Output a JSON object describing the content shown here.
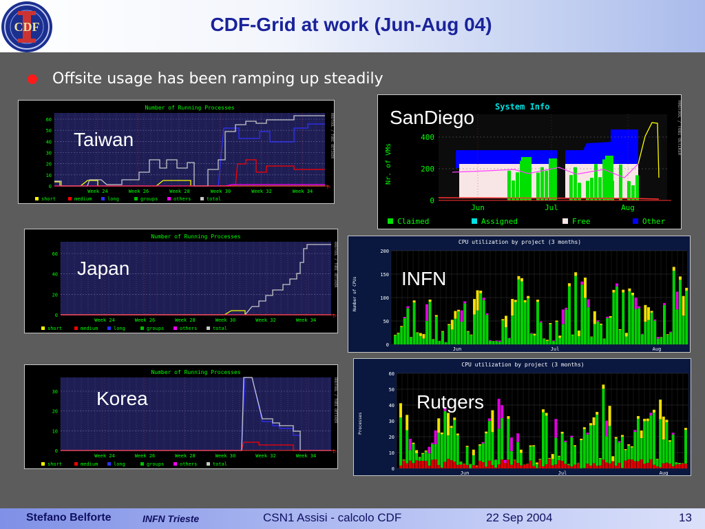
{
  "slide": {
    "title": "CDF-Grid at work (Jun-Aug 04)",
    "bullet": "Offsite usage has been ramping up steadily",
    "logo_text": "CDF",
    "colors": {
      "title": "#1a239a",
      "bullet": "#ff1a1a",
      "background": "#5c5c5c"
    }
  },
  "footer": {
    "author": "Stefano Belforte",
    "institute": "INFN Trieste",
    "event": "CSN1 Assisi - calcolo CDF",
    "date": "22 Sep 2004",
    "page": "13"
  },
  "charts": {
    "taiwan": {
      "label": "Taiwan",
      "title": "Number of Running Processes",
      "side_label": "RRDTOOL / TOBI OETIKER",
      "y_ticks": [
        "0",
        "10",
        "20",
        "30",
        "40",
        "50",
        "60"
      ],
      "x_ticks": [
        "Week 24",
        "Week 26",
        "Week 28",
        "Week 30",
        "Week 32",
        "Week 34"
      ],
      "legend": [
        "short",
        "medium",
        "long",
        "groups",
        "others",
        "total"
      ]
    },
    "japan": {
      "label": "Japan",
      "title": "Number of Running Processes",
      "side_label": "RRDTOOL / TOBI OETIKER",
      "y_ticks": [
        "0",
        "20",
        "40",
        "60"
      ],
      "x_ticks": [
        "Week 24",
        "Week 26",
        "Week 28",
        "Week 30",
        "Week 32",
        "Week 34"
      ],
      "legend": [
        "short",
        "medium",
        "long",
        "groups",
        "others",
        "total"
      ]
    },
    "korea": {
      "label": "Korea",
      "title": "Number of Running Processes",
      "side_label": "RRDTOOL / TOBI OETIKER",
      "y_ticks": [
        "0",
        "10",
        "20",
        "30"
      ],
      "x_ticks": [
        "Week 24",
        "Week 26",
        "Week 28",
        "Week 30",
        "Week 32",
        "Week 34"
      ],
      "legend": [
        "short",
        "medium",
        "long",
        "groups",
        "others",
        "total"
      ]
    },
    "sandiego": {
      "label": "SanDiego",
      "title": "System Info",
      "ylabel": "Nr. of VMs",
      "side_label": "RRDTOOL / TOBI OETIKER",
      "y_ticks": [
        "0",
        "200",
        "400"
      ],
      "x_ticks": [
        "Jun",
        "Jul",
        "Aug"
      ],
      "legend": [
        "Claimed",
        "Assigned",
        "Free",
        "Other"
      ]
    },
    "infn": {
      "label": "INFN",
      "title": "CPU utilization by project (3 months)",
      "ylabel": "Number of CPUs",
      "y_ticks": [
        "0",
        "50",
        "100",
        "150",
        "200"
      ],
      "x_ticks": [
        "Jun",
        "Jul",
        "Aug"
      ]
    },
    "rutgers": {
      "label": "Rutgers",
      "title": "CPU utilization by project (3 months)",
      "ylabel": "Processes",
      "y_ticks": [
        "0",
        "10",
        "20",
        "30",
        "40",
        "50",
        "60"
      ],
      "x_ticks": [
        "Jun",
        "Jul",
        "Aug"
      ]
    }
  }
}
